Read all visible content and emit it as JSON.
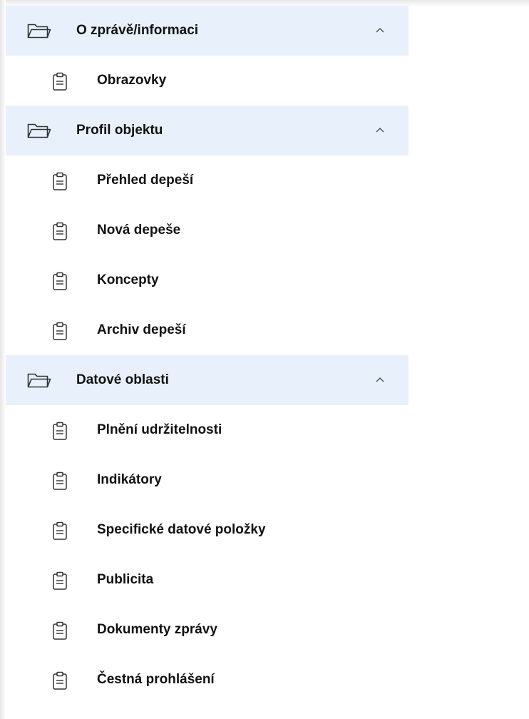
{
  "sections": [
    {
      "title": "O zprávě/informaci",
      "folder_icon": "folder-icon",
      "chevron_icon": "chevron-up-icon",
      "items": [
        {
          "label": "Obrazovky",
          "icon": "clipboard-icon"
        }
      ]
    },
    {
      "title": "Profil objektu",
      "folder_icon": "folder-icon",
      "chevron_icon": "chevron-up-icon",
      "items": [
        {
          "label": "Přehled depeší",
          "icon": "clipboard-icon"
        },
        {
          "label": "Nová depeše",
          "icon": "clipboard-icon"
        },
        {
          "label": "Koncepty",
          "icon": "clipboard-icon"
        },
        {
          "label": "Archiv depeší",
          "icon": "clipboard-icon"
        }
      ]
    },
    {
      "title": "Datové oblasti",
      "folder_icon": "folder-icon",
      "chevron_icon": "chevron-up-icon",
      "items": [
        {
          "label": "Plnění udržitelnosti",
          "icon": "clipboard-icon"
        },
        {
          "label": "Indikátory",
          "icon": "clipboard-icon"
        },
        {
          "label": "Specifické datové položky",
          "icon": "clipboard-icon"
        },
        {
          "label": "Publicita",
          "icon": "clipboard-icon"
        },
        {
          "label": "Dokumenty zprávy",
          "icon": "clipboard-icon"
        },
        {
          "label": "Čestná prohlášení",
          "icon": "clipboard-icon"
        }
      ]
    }
  ],
  "colors": {
    "section_bg": "#e8f1fb",
    "text": "#111111",
    "icon_stroke": "#333333"
  }
}
